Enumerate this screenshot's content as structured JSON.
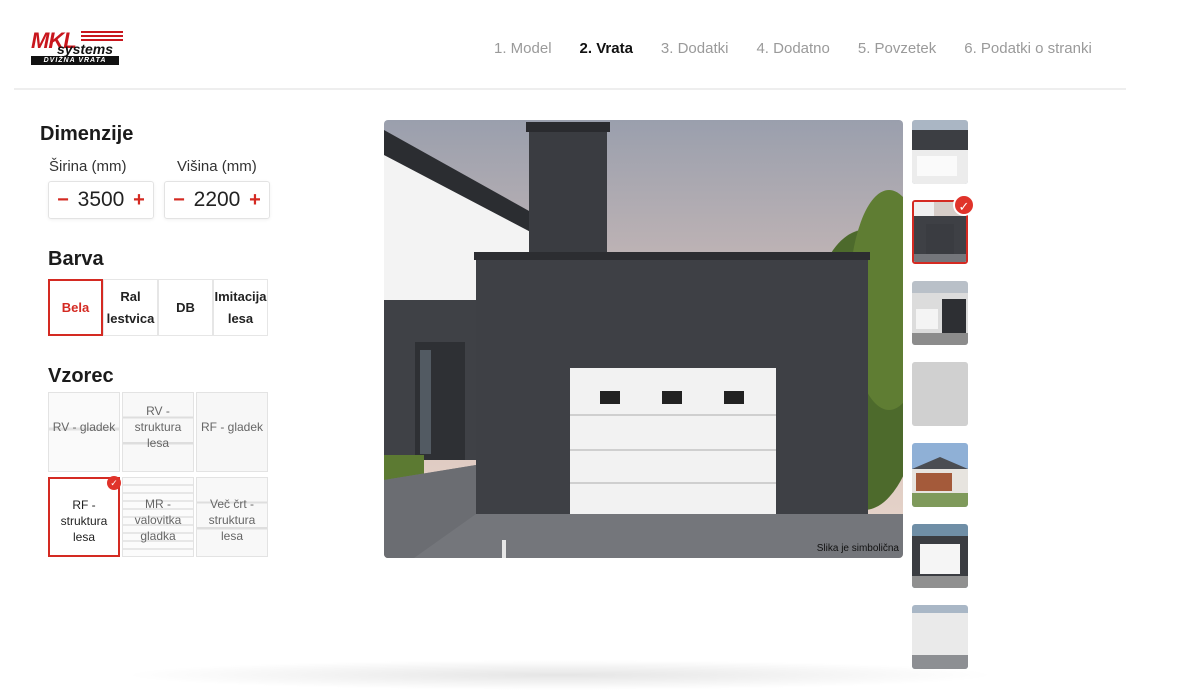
{
  "logo": {
    "brand": "MKL",
    "sub": "systems",
    "tagline": "DVIŽNA VRATA"
  },
  "nav": {
    "steps": [
      {
        "label": "1. Model"
      },
      {
        "label": "2. Vrata"
      },
      {
        "label": "3. Dodatki"
      },
      {
        "label": "4. Dodatno"
      },
      {
        "label": "5. Povzetek"
      },
      {
        "label": "6. Podatki o stranki"
      }
    ],
    "active_index": 1
  },
  "dimensions": {
    "title": "Dimenzije",
    "width": {
      "label": "Širina (mm)",
      "value": "3500",
      "minus": "−",
      "plus": "+"
    },
    "height": {
      "label": "Višina (mm)",
      "value": "2200",
      "minus": "−",
      "plus": "+"
    }
  },
  "color": {
    "title": "Barva",
    "options": [
      {
        "label": "Bela",
        "selected": true
      },
      {
        "label": "Ral lestvica",
        "selected": false
      },
      {
        "label": "DB",
        "selected": false
      },
      {
        "label": "Imitacija lesa",
        "selected": false
      }
    ]
  },
  "pattern": {
    "title": "Vzorec",
    "options": [
      {
        "label": "RV - gladek",
        "selected": false
      },
      {
        "label": "RV - struktura lesa",
        "selected": false
      },
      {
        "label": "RF - gladek",
        "selected": false
      },
      {
        "label": "RF - struktura lesa",
        "selected": true
      },
      {
        "label": "MR - valovitka gladka",
        "selected": false
      },
      {
        "label": "Več črt - struktura lesa",
        "selected": false
      }
    ]
  },
  "preview": {
    "caption": "Slika je simbolična",
    "selected_thumbnail": 1,
    "thumbnail_count": 7
  },
  "colors": {
    "accent": "#d42a22",
    "wall": "#3d3f44",
    "door": "#f4f4f4"
  }
}
